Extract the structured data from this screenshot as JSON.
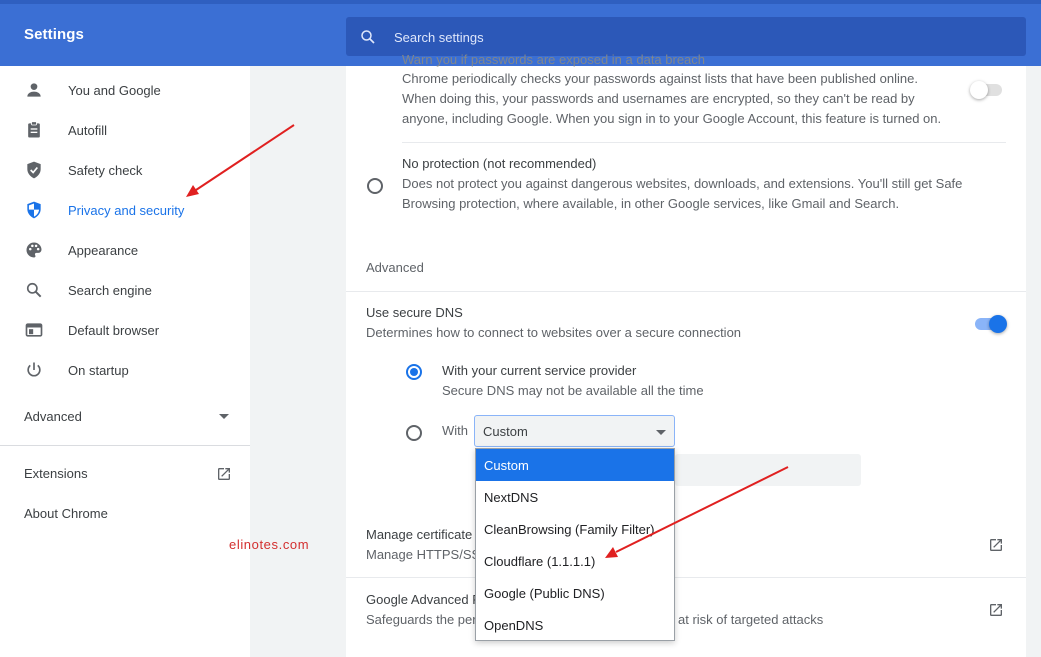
{
  "header": {
    "app_title": "Settings",
    "search_placeholder": "Search settings"
  },
  "sidebar": {
    "items": [
      {
        "label": "You and Google",
        "icon": "person-icon"
      },
      {
        "label": "Autofill",
        "icon": "clipboard-icon"
      },
      {
        "label": "Safety check",
        "icon": "shield-check-icon"
      },
      {
        "label": "Privacy and security",
        "icon": "shield-icon",
        "active": true
      },
      {
        "label": "Appearance",
        "icon": "palette-icon"
      },
      {
        "label": "Search engine",
        "icon": "search-icon"
      },
      {
        "label": "Default browser",
        "icon": "browser-window-icon"
      },
      {
        "label": "On startup",
        "icon": "power-icon"
      }
    ],
    "advanced_label": "Advanced",
    "extensions_label": "Extensions",
    "about_label": "About Chrome",
    "watermark": "elinotes.com"
  },
  "main": {
    "password_warning": {
      "title_partial": "Warn you if passwords are exposed in a data breach",
      "description": "Chrome periodically checks your passwords against lists that have been published online. When doing this, your passwords and usernames are encrypted, so they can't be read by anyone, including Google. When you sign in to your Google Account, this feature is turned on.",
      "line1": "Chrome periodically checks your passwords against lists that have been published online.",
      "line2": "When doing this, your passwords and usernames are encrypted, so they can't be read by",
      "line3": "anyone, including Google. When you sign in to your Google Account, this feature is turned on.",
      "enabled": false
    },
    "no_protection": {
      "title": "No protection (not recommended)",
      "line1": "Does not protect you against dangerous websites, downloads, and extensions. You'll still get Safe",
      "line2": "Browsing protection, where available, in other Google services, like Gmail and Search."
    },
    "advanced_heading": "Advanced",
    "secure_dns": {
      "title": "Use secure DNS",
      "description": "Determines how to connect to websites over a secure connection",
      "enabled": true,
      "option_current_title": "With your current service provider",
      "option_current_desc": "Secure DNS may not be available all the time",
      "option_with_label": "With",
      "select_value": "Custom",
      "dropdown_options": [
        "Custom",
        "NextDNS",
        "CleanBrowsing (Family Filter)",
        "Cloudflare (1.1.1.1)",
        "Google (Public DNS)",
        "OpenDNS"
      ]
    },
    "manage_certificates": {
      "title_partial": "Manage certificate",
      "desc_partial": "Manage HTTPS/SS"
    },
    "advanced_protection": {
      "title_partial": "Google Advanced P",
      "desc_left": "Safeguards the per",
      "desc_right": "at risk of targeted attacks"
    }
  },
  "colors": {
    "header_blue": "#3b6fd4",
    "accent": "#1a73e8",
    "annotation_red": "#e02020"
  }
}
